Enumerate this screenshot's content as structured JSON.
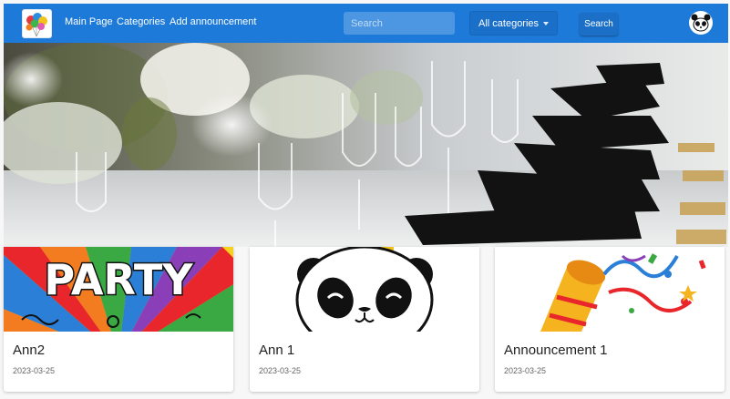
{
  "nav": {
    "links": [
      "Main Page",
      "Categories",
      "Add announcement"
    ],
    "search_placeholder": "Search",
    "category_selected": "All categories",
    "search_button": "Search"
  },
  "hero": {
    "image": "banquet-table-photo"
  },
  "cards": [
    {
      "title": "Ann2",
      "date": "2023-03-25",
      "image": "party-banner",
      "party_text": "PARTY"
    },
    {
      "title": "Ann 1",
      "date": "2023-03-25",
      "image": "panda-face"
    },
    {
      "title": "Announcement 1",
      "date": "2023-03-25",
      "image": "party-popper"
    }
  ],
  "colors": {
    "navbar": "#1e7ad9",
    "accent": "#1b6fc7"
  }
}
